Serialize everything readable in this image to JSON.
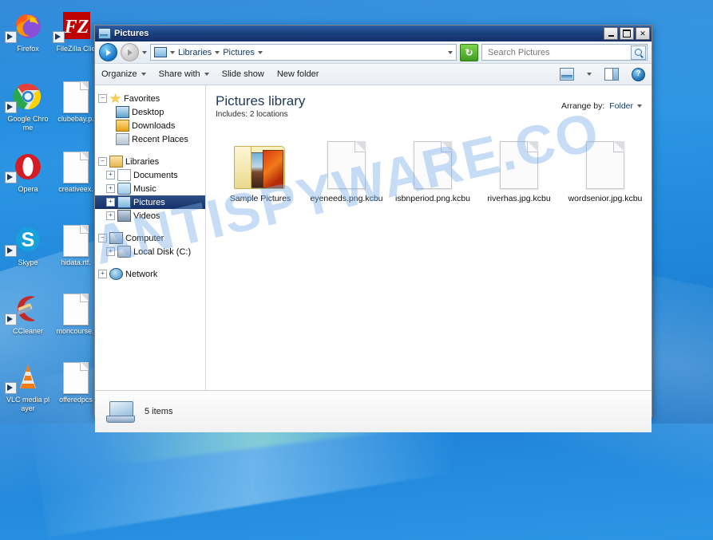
{
  "desktop": {
    "icons": [
      {
        "label": "Firefox",
        "icon": "firefox-icon",
        "type": "app"
      },
      {
        "label": "FileZilla Clie",
        "icon": "filezilla-icon",
        "type": "app"
      },
      {
        "label": "Google Chrome",
        "icon": "chrome-icon",
        "type": "app"
      },
      {
        "label": "clubebay.p.",
        "icon": "document-icon",
        "type": "file"
      },
      {
        "label": "Opera",
        "icon": "opera-icon",
        "type": "app"
      },
      {
        "label": "creativeex.",
        "icon": "document-icon",
        "type": "file"
      },
      {
        "label": "Skype",
        "icon": "skype-icon",
        "type": "app"
      },
      {
        "label": "hidata.rtf.",
        "icon": "document-icon",
        "type": "file"
      },
      {
        "label": "CCleaner",
        "icon": "ccleaner-icon",
        "type": "app"
      },
      {
        "label": "moncourse.j",
        "icon": "document-icon",
        "type": "file"
      },
      {
        "label": "VLC media player",
        "icon": "vlc-icon",
        "type": "app"
      },
      {
        "label": "offeredpcs",
        "icon": "document-icon",
        "type": "file"
      }
    ]
  },
  "window": {
    "title": "Pictures",
    "buttons": {
      "minimize": "_",
      "maximize": "□",
      "close": "✕"
    }
  },
  "address": {
    "back_tooltip": "Back",
    "forward_tooltip": "Forward",
    "breadcrumbs": [
      "Libraries",
      "Pictures"
    ],
    "separator": "▸",
    "refresh_glyph": "↻"
  },
  "search": {
    "placeholder": "Search Pictures",
    "value": ""
  },
  "toolbar": {
    "organize": "Organize",
    "share_with": "Share with",
    "slide_show": "Slide show",
    "new_folder": "New folder",
    "help_glyph": "?"
  },
  "sidebar": {
    "groups": [
      {
        "label": "Favorites",
        "icon": "star-icon",
        "expander": "−",
        "items": [
          {
            "label": "Desktop",
            "icon": "desktop-icon"
          },
          {
            "label": "Downloads",
            "icon": "downloads-icon"
          },
          {
            "label": "Recent Places",
            "icon": "recent-places-icon"
          }
        ]
      },
      {
        "label": "Libraries",
        "icon": "libraries-icon",
        "expander": "−",
        "items": [
          {
            "label": "Documents",
            "icon": "documents-icon",
            "expander": "+"
          },
          {
            "label": "Music",
            "icon": "music-icon",
            "expander": "+"
          },
          {
            "label": "Pictures",
            "icon": "pictures-icon",
            "expander": "+",
            "selected": true
          },
          {
            "label": "Videos",
            "icon": "videos-icon",
            "expander": "+"
          }
        ]
      },
      {
        "label": "Computer",
        "icon": "computer-icon",
        "expander": "−",
        "items": [
          {
            "label": "Local Disk (C:)",
            "icon": "disk-icon",
            "expander": "+"
          }
        ]
      },
      {
        "label": "Network",
        "icon": "network-icon",
        "expander": "+",
        "items": []
      }
    ]
  },
  "library": {
    "title": "Pictures library",
    "includes_label": "Includes:",
    "includes_value": "2 locations",
    "arrange_label": "Arrange by:",
    "arrange_value": "Folder"
  },
  "files": [
    {
      "name": "Sample Pictures",
      "type": "folder"
    },
    {
      "name": "eyeneeds.png.kcbu",
      "type": "file"
    },
    {
      "name": "isbnperiod.png.kcbu",
      "type": "file"
    },
    {
      "name": "riverhas.jpg.kcbu",
      "type": "file"
    },
    {
      "name": "wordsenior.jpg.kcbu",
      "type": "file"
    }
  ],
  "status": {
    "items_text": "5 items"
  },
  "watermark": {
    "text": "ANTISPYWARE.CO"
  },
  "colors": {
    "titlebar": "#1b3f7d",
    "selection": "#16306a",
    "desktop": "#1f86d8",
    "refresh_green": "#3f9c20",
    "watermark": "#78afe6"
  }
}
